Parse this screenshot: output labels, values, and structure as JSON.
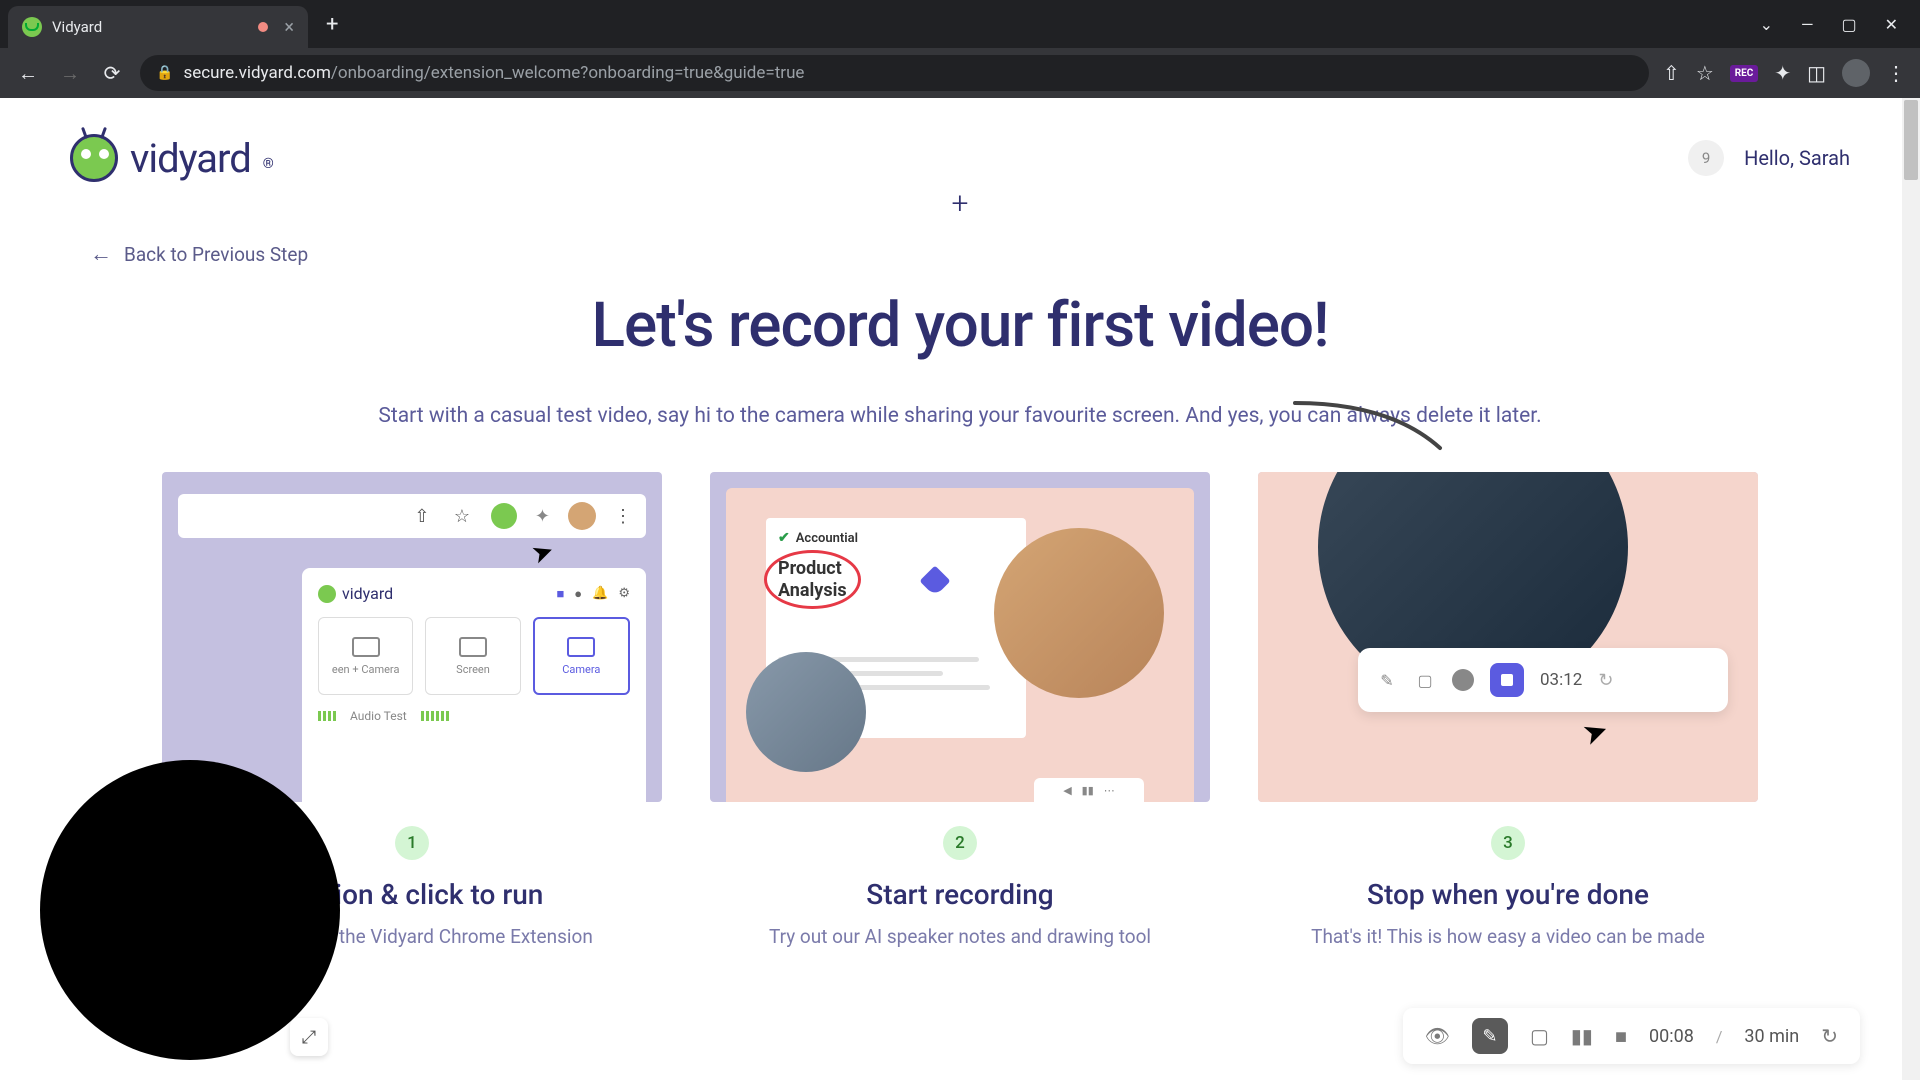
{
  "browser": {
    "tab_title": "Vidyard",
    "url_host": "secure.vidyard.com",
    "url_path": "/onboarding/extension_welcome?onboarding=true&guide=true",
    "rec_badge": "REC"
  },
  "header": {
    "logo_text": "vidyard",
    "notif_count": "9",
    "greeting": "Hello, Sarah"
  },
  "back_link": "Back to Previous Step",
  "hero": {
    "title": "Let's record your first video!",
    "subtitle": "Start with a casual test video, say hi to the camera while sharing your favourite screen. And yes, you can always delete it later."
  },
  "steps": [
    {
      "num": "1",
      "title": "tension & click to run",
      "desc": "Find and pin the Vidyard Chrome Extension",
      "panel_brand": "vidyard",
      "mode1": "een + Camera",
      "mode2": "Screen",
      "mode3": "Camera",
      "audio_label": "Audio Test"
    },
    {
      "num": "2",
      "title": "Start recording",
      "desc": "Try out our AI speaker notes and drawing tool",
      "brand": "Accountial",
      "circled": "Product\nAnalysis"
    },
    {
      "num": "3",
      "title": "Stop when you're done",
      "desc": "That's it! This is how easy a video can be made",
      "time": "03:12"
    }
  ],
  "float_toolbar": {
    "time": "00:08",
    "sep": "/",
    "total": "30 min"
  }
}
